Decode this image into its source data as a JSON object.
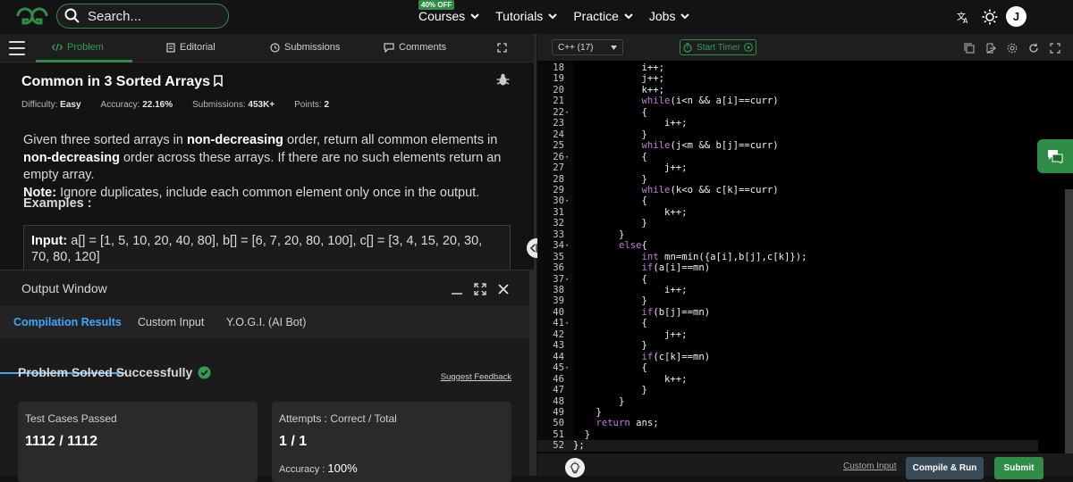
{
  "header": {
    "logo_icon": "gfg-logo-icon",
    "search_placeholder": "Search...",
    "nav": [
      {
        "label": "Courses",
        "badge": "40% OFF"
      },
      {
        "label": "Tutorials"
      },
      {
        "label": "Practice"
      },
      {
        "label": "Jobs"
      }
    ],
    "avatar_initial": "J"
  },
  "problem_tabs": [
    "Problem",
    "Editorial",
    "Submissions",
    "Comments"
  ],
  "problem": {
    "title": "Common in 3 Sorted Arrays",
    "difficulty_label": "Difficulty:",
    "difficulty": "Easy",
    "accuracy_label": "Accuracy:",
    "accuracy": "22.16%",
    "submissions_label": "Submissions:",
    "submissions": "453K+",
    "points_label": "Points:",
    "points": "2",
    "desc_1": "Given three sorted arrays in ",
    "desc_b1": "non-decreasing",
    "desc_2": " order, return all common elements in ",
    "desc_b2": "non-decreasing",
    "desc_3": " order across these arrays. If there are no such elements return an empty array.",
    "note_label": "Note:",
    "note": " Ignore duplicates, include each common element only once in the output.",
    "examples_label": "Examples :",
    "example_input_label": "Input:",
    "example_input": " a[] = [1, 5, 10, 20, 40, 80], b[] = [6, 7, 20, 80, 100], c[] = [3, 4, 15, 20, 30, 70, 80, 120]"
  },
  "output_window": {
    "title": "Output Window",
    "tabs": [
      "Compilation Results",
      "Custom Input",
      "Y.O.G.I. (AI Bot)"
    ],
    "status": "Problem Solved Successfully",
    "feedback": "Suggest Feedback",
    "tests_label": "Test Cases Passed",
    "tests_value": "1112 / 1112",
    "attempts_label": "Attempts : Correct / Total",
    "attempts_value": "1 / 1",
    "accuracy_label": "Accuracy :",
    "accuracy_value": "100%"
  },
  "editor": {
    "language": "C++ (17)",
    "timer_label": "Start Timer",
    "lines": [
      {
        "n": "18",
        "code": "            i++;"
      },
      {
        "n": "19",
        "code": "            j++;"
      },
      {
        "n": "20",
        "code": "            k++;"
      },
      {
        "n": "21",
        "code": "            while(i<n && a[i]==curr)"
      },
      {
        "n": "22",
        "code": "            {",
        "fold": true
      },
      {
        "n": "23",
        "code": "                i++;"
      },
      {
        "n": "24",
        "code": "            }"
      },
      {
        "n": "25",
        "code": "            while(j<m && b[j]==curr)"
      },
      {
        "n": "26",
        "code": "            {",
        "fold": true
      },
      {
        "n": "27",
        "code": "                j++;"
      },
      {
        "n": "28",
        "code": "            }"
      },
      {
        "n": "29",
        "code": "            while(k<o && c[k]==curr)"
      },
      {
        "n": "30",
        "code": "            {",
        "fold": true
      },
      {
        "n": "31",
        "code": "                k++;"
      },
      {
        "n": "32",
        "code": "            }"
      },
      {
        "n": "33",
        "code": "        }"
      },
      {
        "n": "34",
        "code": "        else{",
        "fold": true
      },
      {
        "n": "35",
        "code": "            int mn=min({a[i],b[j],c[k]});"
      },
      {
        "n": "36",
        "code": "            if(a[i]==mn)"
      },
      {
        "n": "37",
        "code": "            {",
        "fold": true
      },
      {
        "n": "38",
        "code": "                i++;"
      },
      {
        "n": "39",
        "code": "            }"
      },
      {
        "n": "40",
        "code": "            if(b[j]==mn)"
      },
      {
        "n": "41",
        "code": "            {",
        "fold": true
      },
      {
        "n": "42",
        "code": "                j++;"
      },
      {
        "n": "43",
        "code": "            }"
      },
      {
        "n": "44",
        "code": "            if(c[k]==mn)"
      },
      {
        "n": "45",
        "code": "            {",
        "fold": true
      },
      {
        "n": "46",
        "code": "                k++;"
      },
      {
        "n": "47",
        "code": "            }"
      },
      {
        "n": "48",
        "code": "        }"
      },
      {
        "n": "49",
        "code": "    }"
      },
      {
        "n": "50",
        "code": "    return ans;"
      },
      {
        "n": "51",
        "code": "  }"
      },
      {
        "n": "52",
        "code": "};"
      }
    ],
    "custom_input": "Custom Input",
    "run_label": "Compile & Run",
    "submit_label": "Submit"
  },
  "colors": {
    "brand": "#2f8d46",
    "accent": "#3ea6ff",
    "keyword": "#c678dd"
  }
}
